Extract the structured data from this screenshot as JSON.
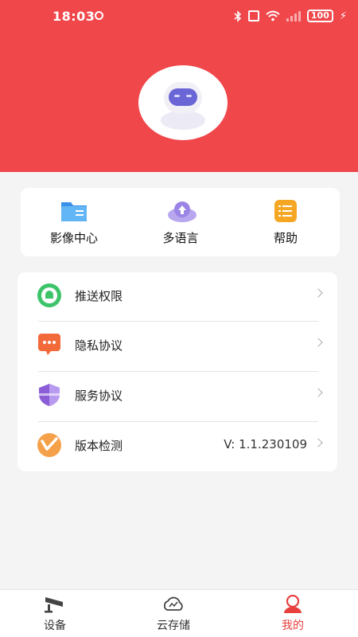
{
  "status_bar": {
    "time": "18:03",
    "battery": "100"
  },
  "profile": {
    "avatar_icon": "robot-avatar-icon"
  },
  "quick_actions": [
    {
      "label": "影像中心",
      "icon": "folder-icon"
    },
    {
      "label": "多语言",
      "icon": "cloud-upload-icon"
    },
    {
      "label": "帮助",
      "icon": "help-list-icon"
    }
  ],
  "menu": {
    "items": [
      {
        "label": "推送权限",
        "icon": "bell-icon"
      },
      {
        "label": "隐私协议",
        "icon": "message-dots-icon"
      },
      {
        "label": "服务协议",
        "icon": "shield-icon"
      },
      {
        "label": "版本检测",
        "icon": "version-icon",
        "value": "V: 1.1.230109"
      }
    ]
  },
  "tabbar": {
    "tabs": [
      {
        "label": "设备",
        "icon": "camera-icon"
      },
      {
        "label": "云存储",
        "icon": "cloud-icon"
      },
      {
        "label": "我的",
        "icon": "person-icon",
        "active": true
      }
    ]
  },
  "colors": {
    "accent": "#f0474b",
    "active_tab": "#e8403f"
  }
}
